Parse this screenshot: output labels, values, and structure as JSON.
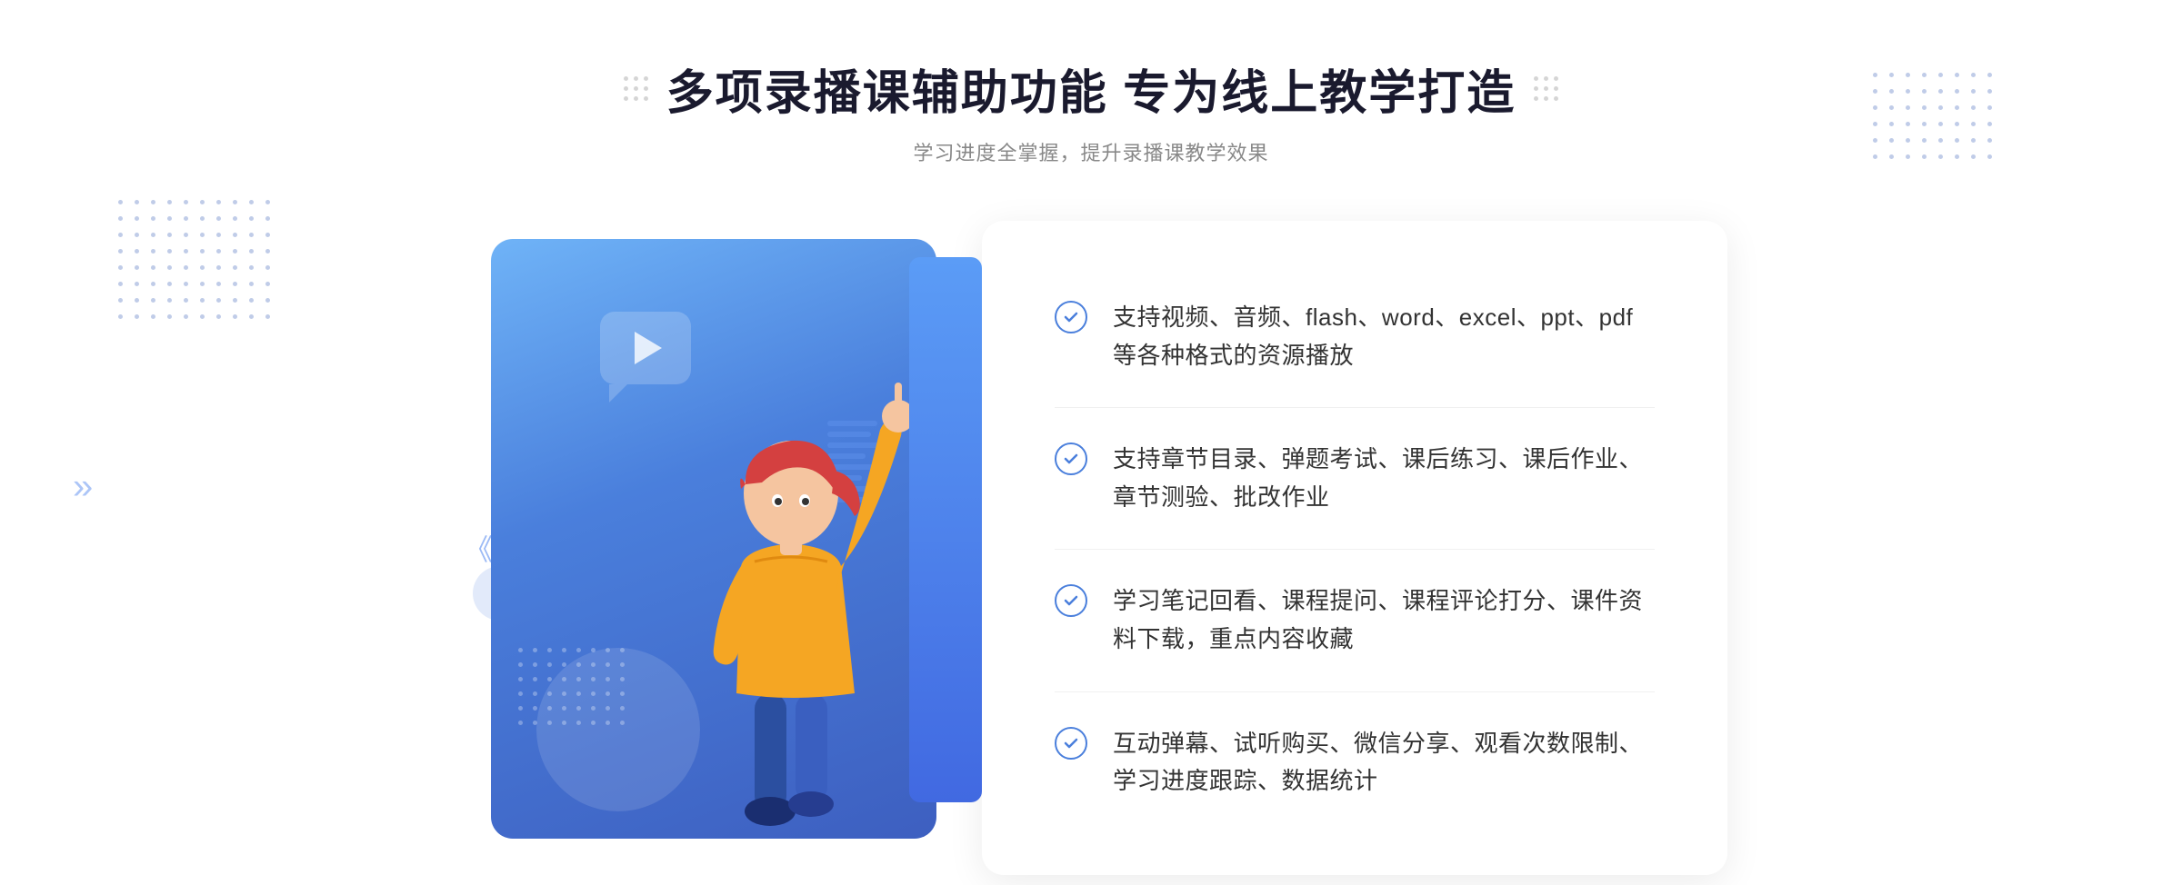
{
  "header": {
    "title": "多项录播课辅助功能 专为线上教学打造",
    "subtitle": "学习进度全掌握，提升录播课教学效果",
    "title_dots_label": "decorative dots"
  },
  "features": [
    {
      "id": 1,
      "text": "支持视频、音频、flash、word、excel、ppt、pdf等各种格式的资源播放"
    },
    {
      "id": 2,
      "text": "支持章节目录、弹题考试、课后练习、课后作业、章节测验、批改作业"
    },
    {
      "id": 3,
      "text": "学习笔记回看、课程提问、课程评论打分、课件资料下载，重点内容收藏"
    },
    {
      "id": 4,
      "text": "互动弹幕、试听购买、微信分享、观看次数限制、学习进度跟踪、数据统计"
    }
  ],
  "illustration": {
    "play_icon": "▶",
    "arrow_prev": "《"
  },
  "colors": {
    "blue_primary": "#4a7fdc",
    "blue_light": "#6fb3f7",
    "blue_panel": "#4169e1",
    "text_dark": "#1a1a2e",
    "text_gray": "#888888",
    "text_feature": "#333333"
  }
}
